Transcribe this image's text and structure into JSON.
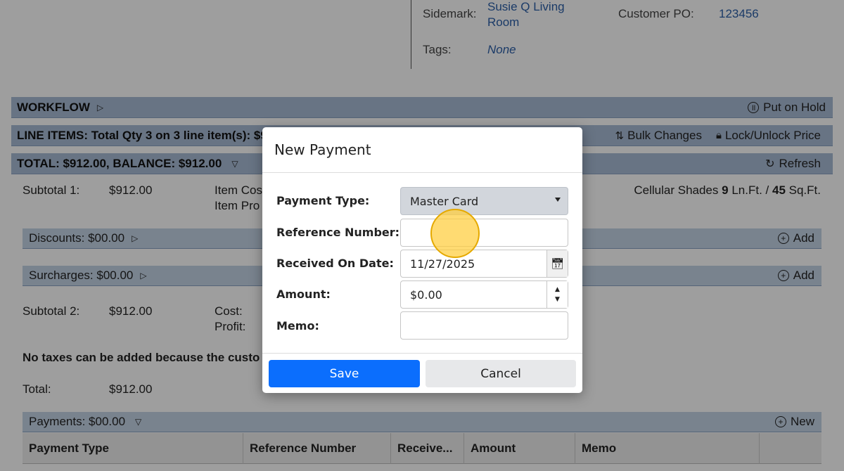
{
  "header": {
    "sidemark_label": "Sidemark:",
    "sidemark_value_line1": "Susie Q Living",
    "sidemark_value_line2": "Room",
    "customer_po_label": "Customer PO:",
    "customer_po_value": "123456",
    "tags_label": "Tags:",
    "tags_value": "None"
  },
  "workflow": {
    "title": "WORKFLOW",
    "action": "Put on Hold"
  },
  "line_items": {
    "title": "LINE ITEMS: Total Qty 3 on 3 line item(s): $9",
    "bulk_changes": "Bulk Changes",
    "lock_unlock": "Lock/Unlock Price"
  },
  "totals": {
    "title": "TOTAL: $912.00, BALANCE: $912.00",
    "refresh": "Refresh",
    "subtotal1_label": "Subtotal 1:",
    "subtotal1_value": "$912.00",
    "item_cost_label": "Item Cos",
    "item_profit_label": "Item Pro",
    "product_summary_name": "Cellular Shades",
    "product_summary_qty": "9",
    "product_summary_unit1": "Ln.Ft. /",
    "product_summary_area": "45",
    "product_summary_unit2": "Sq.Ft.",
    "discounts": "Discounts: $00.00",
    "discounts_add": "Add",
    "surcharges": "Surcharges: $00.00",
    "surcharges_add": "Add",
    "subtotal2_label": "Subtotal 2:",
    "subtotal2_value": "$912.00",
    "cost_label": "Cost:",
    "profit_label": "Profit:",
    "tax_note": "No taxes can be added because the custo",
    "total_label": "Total:",
    "total_value": "$912.00"
  },
  "payments": {
    "title": "Payments: $00.00",
    "new": "New",
    "columns": [
      "Payment Type",
      "Reference Number",
      "Receive...",
      "Amount",
      "Memo"
    ]
  },
  "modal": {
    "title": "New Payment",
    "payment_type_label": "Payment Type:",
    "payment_type_value": "Master Card",
    "reference_label": "Reference Number:",
    "reference_value": "",
    "received_label": "Received On Date:",
    "received_value": "11/27/2025",
    "amount_label": "Amount:",
    "amount_value": "$0.00",
    "memo_label": "Memo:",
    "memo_value": "",
    "save": "Save",
    "cancel": "Cancel"
  },
  "icons": {
    "workflow_toggle": "triangle-right-icon",
    "hold": "pause-circle-icon",
    "bulk": "bulk-changes-icon",
    "lock": "lock-icon",
    "refresh": "refresh-icon",
    "add": "plus-circle-icon",
    "calendar": "calendar-icon"
  },
  "colors": {
    "section_bar": "#a9bcd6",
    "sub_bar": "#c4d3e6",
    "link": "#2c5fa8",
    "save_button": "#0b6efd",
    "cursor_highlight": "#ffcd3c"
  }
}
